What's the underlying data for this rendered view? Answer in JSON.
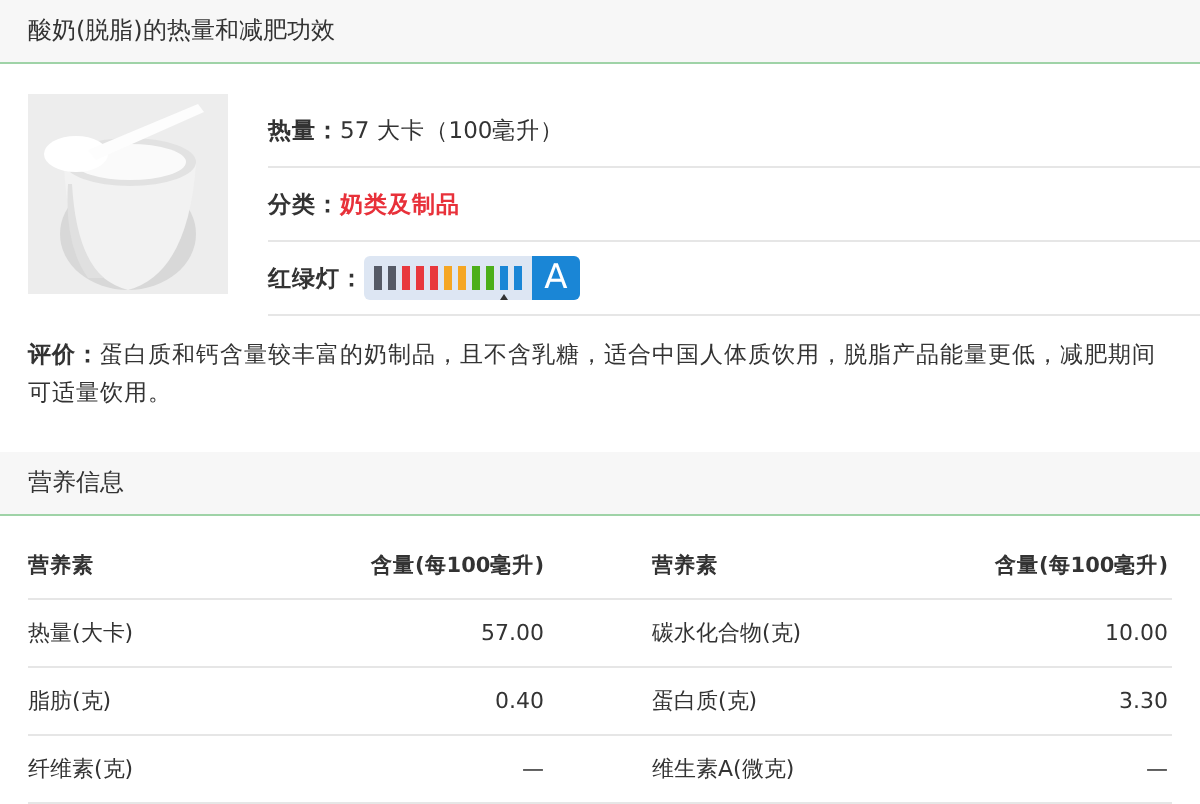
{
  "title": "酸奶(脱脂)的热量和减肥功效",
  "food": {
    "fields": [
      {
        "label": "热量：",
        "value": "57 大卡（100毫升）",
        "kind": "plain"
      },
      {
        "label": "分类：",
        "value": "奶类及制品",
        "kind": "link"
      },
      {
        "label": "红绿灯：",
        "kind": "lights",
        "grade": "A",
        "bars": [
          {
            "color": "#555a66",
            "selected": false
          },
          {
            "color": "#555a66",
            "selected": false
          },
          {
            "color": "#e8383d",
            "selected": false
          },
          {
            "color": "#e8383d",
            "selected": false
          },
          {
            "color": "#e8383d",
            "selected": false
          },
          {
            "color": "#f5a623",
            "selected": false
          },
          {
            "color": "#f5a623",
            "selected": false
          },
          {
            "color": "#4caf1a",
            "selected": false
          },
          {
            "color": "#4caf1a",
            "selected": false
          },
          {
            "color": "#1a86d6",
            "selected": true
          },
          {
            "color": "#1a86d6",
            "selected": false
          }
        ]
      }
    ],
    "review": "**评价：**蛋白质和钙含量较丰富的奶制品，且不含乳糖，适合中国人体质饮用，脱脂产品能量更低，减肥期间可适量饮用。"
  },
  "nutrition": {
    "title": "营养信息",
    "columns": [
      "营养素",
      "含量(每100毫升)",
      "营养素",
      "含量(每100毫升)"
    ],
    "rows": [
      [
        "热量(大卡)",
        "57.00",
        "碳水化合物(克)",
        "10.00"
      ],
      [
        "脂肪(克)",
        "0.40",
        "蛋白质(克)",
        "3.30"
      ],
      [
        "纤维素(克)",
        "—",
        "维生素A(微克)",
        "—"
      ]
    ]
  }
}
